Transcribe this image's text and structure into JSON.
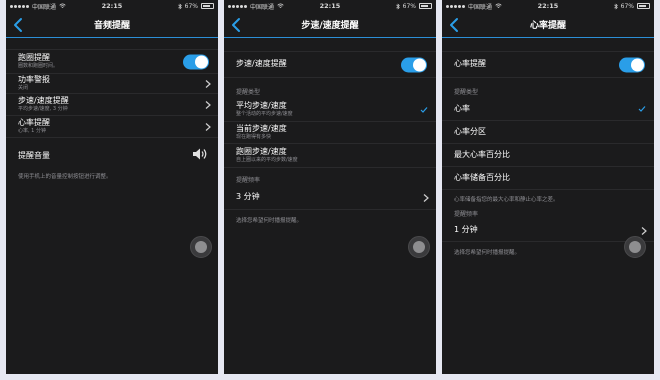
{
  "colors": {
    "accent": "#2a9ee8",
    "panel": "#1b1b1c",
    "backdrop": "#e6e8f2"
  },
  "status": {
    "carrier": "中国联通",
    "time": "22:15",
    "battery": "67%",
    "battery_level": 0.67
  },
  "screens": [
    {
      "title": "音频提醒",
      "rows": [
        {
          "title": "跑圈提醒",
          "subtitle": "圈数和跑圈时间。",
          "control": "toggle",
          "on": true
        },
        {
          "title": "功率警报",
          "subtitle": "关闭",
          "control": "chevron"
        },
        {
          "title": "步速/速度提醒",
          "subtitle": "平均步速/速度, 3 分钟",
          "control": "chevron"
        },
        {
          "title": "心率提醒",
          "subtitle": "心率, 1 分钟",
          "control": "chevron"
        },
        {
          "title": "提醒音量",
          "control": "speaker-icon"
        }
      ],
      "footnote": "使用手机上的音量控制按钮进行调整。"
    },
    {
      "title": "步速/速度提醒",
      "toggle_row": {
        "title": "步速/速度提醒",
        "on": true
      },
      "type_label": "提醒类型",
      "types": [
        {
          "title": "平均步速/速度",
          "subtitle": "整个活动的平均步速/速度",
          "selected": true
        },
        {
          "title": "当前步速/速度",
          "subtitle": "现在跑得有多快",
          "selected": false
        },
        {
          "title": "跑圈步速/速度",
          "subtitle": "自上圈以来的平均步数/速度",
          "selected": false
        }
      ],
      "freq_label": "提醒频率",
      "freq_value": "3 分钟",
      "footnote": "选择您希望何时播报提醒。"
    },
    {
      "title": "心率提醒",
      "toggle_row": {
        "title": "心率提醒",
        "on": true
      },
      "type_label": "提醒类型",
      "types": [
        {
          "title": "心率",
          "selected": true
        },
        {
          "title": "心率分区",
          "selected": false
        },
        {
          "title": "最大心率百分比",
          "selected": false
        },
        {
          "title": "心率储备百分比",
          "selected": false
        }
      ],
      "type_footnote": "心率储备指您的最大心率和静止心率之差。",
      "freq_label": "提醒频率",
      "freq_value": "1 分钟",
      "footnote": "选择您希望何时播报提醒。"
    }
  ]
}
